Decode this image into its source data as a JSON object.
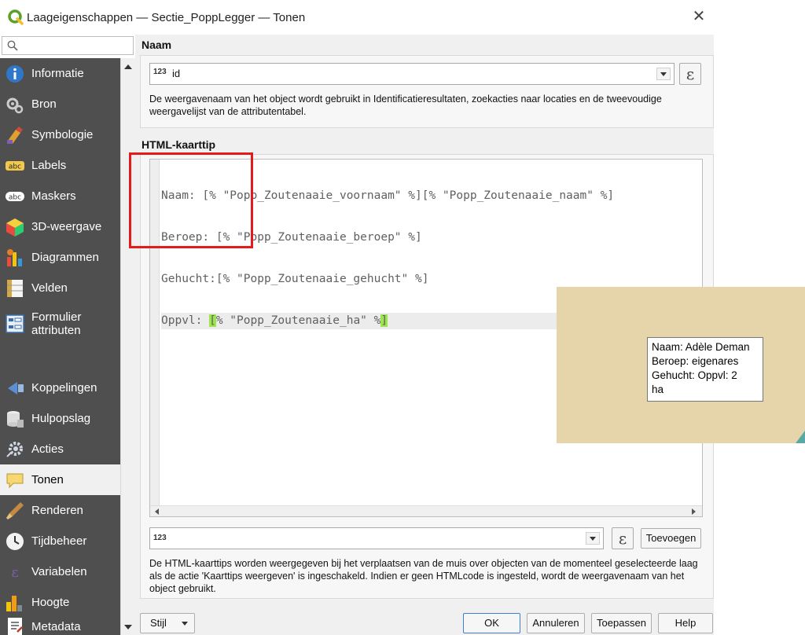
{
  "window": {
    "title": "Laageigenschappen — Sectie_PoppLegger — Tonen",
    "close_glyph": "✕"
  },
  "sidebar": {
    "search_placeholder": "",
    "items": [
      {
        "label": "Informatie",
        "icon": "info-icon"
      },
      {
        "label": "Bron",
        "icon": "source-icon"
      },
      {
        "label": "Symbologie",
        "icon": "symbology-icon"
      },
      {
        "label": "Labels",
        "icon": "labels-icon"
      },
      {
        "label": "Maskers",
        "icon": "masks-icon"
      },
      {
        "label": "3D-weergave",
        "icon": "3d-view-icon"
      },
      {
        "label": "Diagrammen",
        "icon": "diagrams-icon"
      },
      {
        "label": "Velden",
        "icon": "fields-icon"
      },
      {
        "label": "Formulier attributen",
        "icon": "attributes-form-icon"
      },
      {
        "label": "Koppelingen",
        "icon": "joins-icon"
      },
      {
        "label": "Hulpopslag",
        "icon": "auxiliary-storage-icon"
      },
      {
        "label": "Acties",
        "icon": "actions-icon"
      },
      {
        "label": "Tonen",
        "icon": "display-icon"
      },
      {
        "label": "Renderen",
        "icon": "rendering-icon"
      },
      {
        "label": "Tijdbeheer",
        "icon": "temporal-icon"
      },
      {
        "label": "Variabelen",
        "icon": "variables-icon"
      },
      {
        "label": "Hoogte",
        "icon": "elevation-icon"
      },
      {
        "label": "Metadata",
        "icon": "metadata-icon"
      }
    ],
    "active_index": 12
  },
  "naam": {
    "section_label": "Naam",
    "field_type": "123",
    "field_value": "id",
    "expression_symbol": "ε",
    "help": "De weergavenaam van het object wordt gebruikt in Identificatieresultaten, zoekacties naar locaties en de tweevoudige weergavelijst van de attributentabel."
  },
  "html_tip": {
    "section_label": "HTML-kaarttip",
    "code_lines": [
      "Naam: [% \"Popp_Zoutenaaie_voornaam\" %][% \"Popp_Zoutenaaie_naam\" %]",
      "Beroep: [% \"Popp_Zoutenaaie_beroep\" %]",
      "Gehucht:[% \"Popp_Zoutenaaie_gehucht\" %]",
      "Oppvl: [% \"Popp_Zoutenaaie_ha\" %]"
    ],
    "field_type": "123",
    "expression_symbol": "ε",
    "insert_button": "Toevoegen",
    "help": "De HTML-kaarttips worden weergegeven bij het verplaatsen van de muis over objecten van de momenteel geselecteerde laag als de actie 'Kaarttips weergeven' is ingeschakeld. Indien er geen HTMLcode is ingesteld, wordt de weergavenaam van het object gebruikt."
  },
  "footer": {
    "style_button": "Stijl",
    "ok": "OK",
    "cancel": "Annuleren",
    "apply": "Toepassen",
    "help": "Help"
  },
  "map_preview": {
    "tooltip_lines": [
      "Naam: Adèle Deman",
      "Beroep: eigenares",
      "Gehucht: Oppvl: 2",
      "ha"
    ]
  },
  "colors": {
    "sidebar_bg": "#4f4f4f",
    "highlight_green": "#9ee44f",
    "annotation_red": "#e31b1b",
    "preview_bg": "#e6d5aa"
  }
}
